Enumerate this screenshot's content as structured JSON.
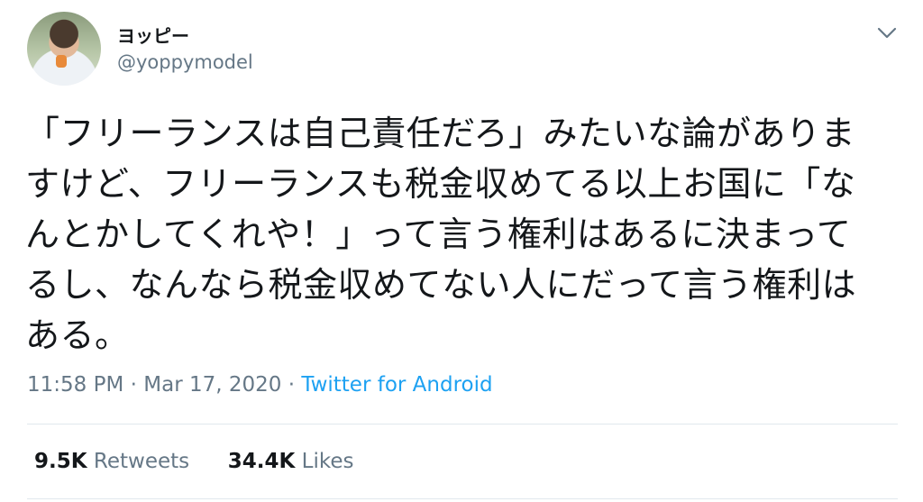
{
  "tweet": {
    "display_name": "ヨッピー",
    "handle": "@yoppymodel",
    "text_lines": [
      "「フリーランスは自己責任だろ」みたいな論がありま",
      "すけど、フリーランスも税金収めてる以上お国に「な",
      "んとかしてくれや！」って言う権利はあるに決まって",
      "るし、なんなら税金収めてない人にだって言う権利は",
      "ある。"
    ],
    "time": "11:58 PM",
    "separator1": "·",
    "date": "Mar 17, 2020",
    "separator2": "·",
    "source": "Twitter for Android",
    "retweets_count": "9.5K",
    "retweets_label": "Retweets",
    "likes_count": "34.4K",
    "likes_label": "Likes"
  },
  "icons": {
    "caret": "chevron-down-icon",
    "avatar": "avatar"
  },
  "colors": {
    "text": "#14171a",
    "secondary": "#657786",
    "link": "#1da1f2",
    "divider": "#e1e8ed"
  }
}
